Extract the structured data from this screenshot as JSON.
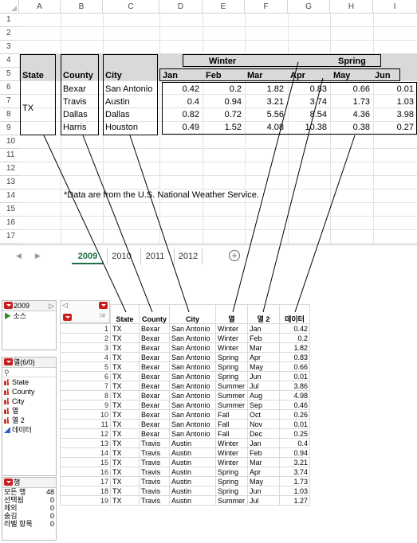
{
  "excel": {
    "columns": [
      "A",
      "B",
      "C",
      "D",
      "E",
      "F",
      "G",
      "H",
      "I"
    ],
    "rows": [
      "1",
      "2",
      "3",
      "4",
      "5",
      "6",
      "7",
      "8",
      "9",
      "10",
      "11",
      "12",
      "13",
      "14",
      "15",
      "16",
      "17"
    ],
    "season_headers": {
      "winter": "Winter",
      "spring": "Spring"
    },
    "headers": {
      "state": "State",
      "county": "County",
      "city": "City",
      "months": [
        "Jan",
        "Feb",
        "Mar",
        "Apr",
        "May",
        "Jun"
      ]
    },
    "state_value": "TX",
    "data_rows": [
      {
        "county": "Bexar",
        "city": "San Antonio",
        "values": [
          "0.42",
          "0.2",
          "1.82",
          "0.83",
          "0.66",
          "0.01"
        ]
      },
      {
        "county": "Travis",
        "city": "Austin",
        "values": [
          "0.4",
          "0.94",
          "3.21",
          "3.74",
          "1.73",
          "1.03"
        ]
      },
      {
        "county": "Dallas",
        "city": "Dallas",
        "values": [
          "0.82",
          "0.72",
          "5.56",
          "8.54",
          "4.36",
          "3.98"
        ]
      },
      {
        "county": "Harris",
        "city": "Houston",
        "values": [
          "0.49",
          "1.52",
          "4.08",
          "10.38",
          "0.38",
          "0.27"
        ]
      }
    ],
    "note": "*Data are from the U.S. National Weather Service.",
    "tabs": [
      "2009",
      "2010",
      "2011",
      "2012"
    ],
    "active_tab": "2009",
    "add_sheet_icon": "plus-circle-icon"
  },
  "jmp": {
    "table_name": "2009",
    "source_label": "소스",
    "columns_panel_title": "열(6/0)",
    "column_list": [
      {
        "name": "State",
        "type": "nominal"
      },
      {
        "name": "County",
        "type": "nominal"
      },
      {
        "name": "City",
        "type": "nominal"
      },
      {
        "name": "열",
        "type": "nominal"
      },
      {
        "name": "열 2",
        "type": "nominal"
      },
      {
        "name": "데이터",
        "type": "continuous"
      }
    ],
    "rows_panel_title": "행",
    "row_stats": [
      {
        "label": "모든 행",
        "value": "48"
      },
      {
        "label": "선택됨",
        "value": "0"
      },
      {
        "label": "제외",
        "value": "0"
      },
      {
        "label": "숨김",
        "value": "0"
      },
      {
        "label": "라벨 항목",
        "value": "0"
      }
    ],
    "table_headers": [
      "State",
      "County",
      "City",
      "열",
      "열 2",
      "데이터"
    ],
    "table_rows": [
      [
        "1",
        "TX",
        "Bexar",
        "San Antonio",
        "Winter",
        "Jan",
        "0.42"
      ],
      [
        "2",
        "TX",
        "Bexar",
        "San Antonio",
        "Winter",
        "Feb",
        "0.2"
      ],
      [
        "3",
        "TX",
        "Bexar",
        "San Antonio",
        "Winter",
        "Mar",
        "1.82"
      ],
      [
        "4",
        "TX",
        "Bexar",
        "San Antonio",
        "Spring",
        "Apr",
        "0.83"
      ],
      [
        "5",
        "TX",
        "Bexar",
        "San Antonio",
        "Spring",
        "May",
        "0.66"
      ],
      [
        "6",
        "TX",
        "Bexar",
        "San Antonio",
        "Spring",
        "Jun",
        "0.01"
      ],
      [
        "7",
        "TX",
        "Bexar",
        "San Antonio",
        "Summer",
        "Jul",
        "3.86"
      ],
      [
        "8",
        "TX",
        "Bexar",
        "San Antonio",
        "Summer",
        "Aug",
        "4.98"
      ],
      [
        "9",
        "TX",
        "Bexar",
        "San Antonio",
        "Summer",
        "Sep",
        "0.46"
      ],
      [
        "10",
        "TX",
        "Bexar",
        "San Antonio",
        "Fall",
        "Oct",
        "0.26"
      ],
      [
        "11",
        "TX",
        "Bexar",
        "San Antonio",
        "Fall",
        "Nov",
        "0.01"
      ],
      [
        "12",
        "TX",
        "Bexar",
        "San Antonio",
        "Fall",
        "Dec",
        "0.25"
      ],
      [
        "13",
        "TX",
        "Travis",
        "Austin",
        "Winter",
        "Jan",
        "0.4"
      ],
      [
        "14",
        "TX",
        "Travis",
        "Austin",
        "Winter",
        "Feb",
        "0.94"
      ],
      [
        "15",
        "TX",
        "Travis",
        "Austin",
        "Winter",
        "Mar",
        "3.21"
      ],
      [
        "16",
        "TX",
        "Travis",
        "Austin",
        "Spring",
        "Apr",
        "3.74"
      ],
      [
        "17",
        "TX",
        "Travis",
        "Austin",
        "Spring",
        "May",
        "1.73"
      ],
      [
        "18",
        "TX",
        "Travis",
        "Austin",
        "Spring",
        "Jun",
        "1.03"
      ],
      [
        "19",
        "TX",
        "Travis",
        "Austin",
        "Summer",
        "Jul",
        "1.27"
      ]
    ]
  },
  "colors": {
    "sheet_header_band": "#d9d9d9",
    "active_tab": "#1e7145",
    "red_menu": "#c81e1e",
    "continuous_icon": "#2e5fc4"
  }
}
